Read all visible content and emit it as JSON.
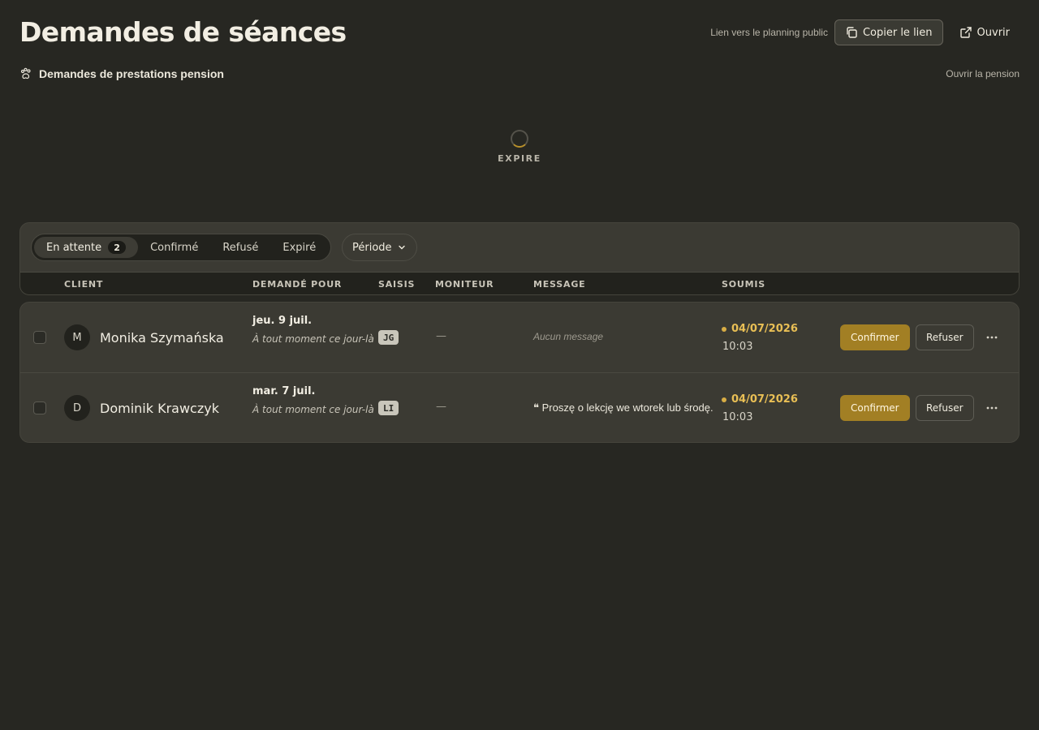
{
  "page": {
    "title": "Demandes de séances",
    "public_link_label": "Lien vers le planning public",
    "copy_link_label": "Copier le lien",
    "open_label": "Ouvrir",
    "subtitle": "Demandes de prestations pension",
    "open_pension_label": "Ouvrir la pension"
  },
  "status": {
    "loading_label": "EXPIRE"
  },
  "filters": {
    "tabs": [
      {
        "label": "En attente",
        "count": "2",
        "active": true
      },
      {
        "label": "Confirmé"
      },
      {
        "label": "Refusé"
      },
      {
        "label": "Expiré"
      }
    ],
    "period_label": "Période"
  },
  "table": {
    "columns": [
      "CLIENT",
      "DEMANDÉ POUR",
      "SAISIS",
      "MONITEUR",
      "MESSAGE",
      "SOUMIS"
    ],
    "rows": [
      {
        "avatar": "M",
        "client": "Monika Szymańska",
        "requested_date": "jeu. 9 juil.",
        "requested_note": "À tout moment ce jour-là",
        "entered_by": "JG",
        "monitor": "—",
        "message": "Aucun message",
        "message_empty": true,
        "submitted_date": "04/07/2026",
        "submitted_time": "10:03",
        "confirm_label": "Confirmer",
        "refuse_label": "Refuser"
      },
      {
        "avatar": "D",
        "client": "Dominik Krawczyk",
        "requested_date": "mar. 7 juil.",
        "requested_note": "À tout moment ce jour-là",
        "entered_by": "LI",
        "monitor": "—",
        "message_quote": "❝",
        "message": "Proszę o lekcję we wtorek lub środę.",
        "message_empty": false,
        "submitted_date": "04/07/2026",
        "submitted_time": "10:03",
        "confirm_label": "Confirmer",
        "refuse_label": "Refuser"
      }
    ]
  },
  "colors": {
    "background": "#272722",
    "card": "#3b3a33",
    "accent": "#a27f24",
    "date_highlight": "#e9bf55"
  }
}
